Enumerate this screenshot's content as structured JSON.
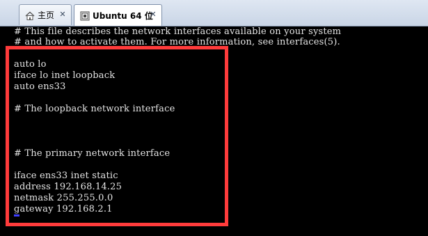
{
  "tabs": [
    {
      "label": "主页",
      "icon": "home-icon",
      "active": false
    },
    {
      "label": "Ubuntu 64 位",
      "icon": "vm-icon",
      "active": true
    }
  ],
  "close_glyph": "✕",
  "terminal": {
    "lines": [
      "# This file describes the network interfaces available on your system",
      "# and how to activate them. For more information, see interfaces(5).",
      "",
      "auto lo",
      "iface lo inet loopback",
      "auto ens33",
      "",
      "# The loopback network interface",
      "",
      "",
      "",
      "# The primary network interface",
      "",
      "iface ens33 inet static",
      "address 192.168.14.25",
      "netmask 255.255.0.0",
      "gateway 192.168.2.1"
    ]
  },
  "colors": {
    "highlight": "#ff3b3b",
    "terminal_bg": "#000000",
    "terminal_fg": "#e6e6e6",
    "cursor": "#3f3fff"
  }
}
